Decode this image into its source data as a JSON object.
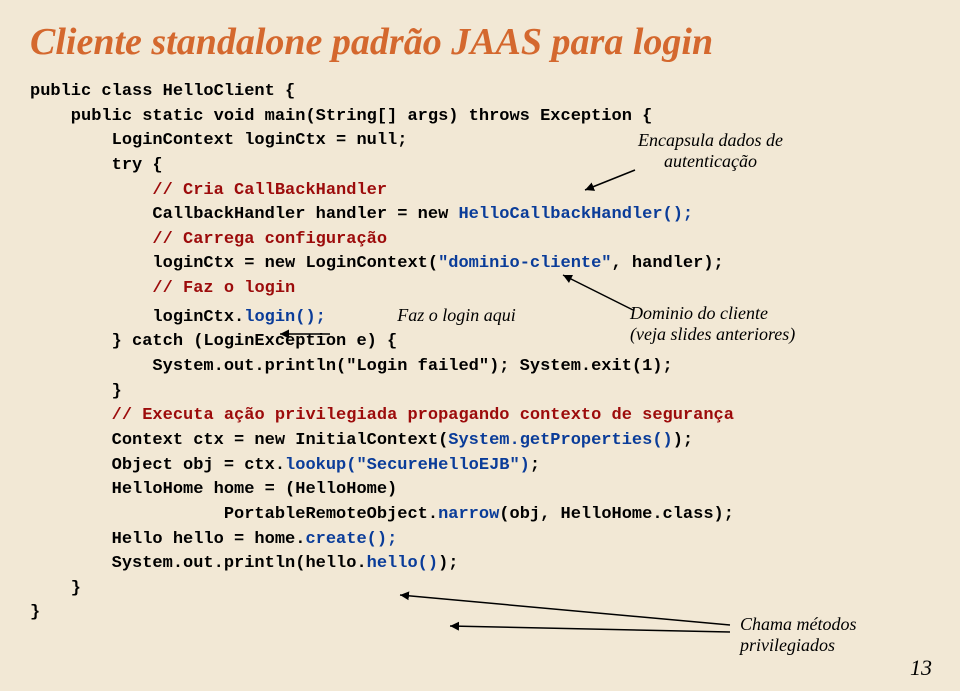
{
  "title": "Cliente standalone padrão JAAS para login",
  "code": {
    "l1": "public class HelloClient {",
    "l2": "    public static void main(String[] args) throws Exception {",
    "l3": "        LoginContext loginCtx = null;",
    "l4": "        try {",
    "l5": "            ",
    "l5c": "// Cria CallBackHandler",
    "l6a": "            CallbackHandler handler = new ",
    "l6b": "HelloCallbackHandler();",
    "l7": "            ",
    "l7c": "// Carrega configuração",
    "l8a": "            loginCtx = new LoginContext(",
    "l8b": "\"dominio-cliente\"",
    "l8c": ", handler);",
    "l9": "            ",
    "l9c": "// Faz o login",
    "l10a": "            loginCtx.",
    "l10b": "login();",
    "l11": "        } catch (LoginException e) {",
    "l12": "            System.out.println(\"Login failed\"); System.exit(1);",
    "l13": "        }",
    "l14": "        ",
    "l14c": "// Executa ação privilegiada propagando contexto de segurança",
    "l15a": "        Context ctx = new InitialContext(",
    "l15b": "System.getProperties()",
    "l15c": ");",
    "l16a": "        Object obj = ctx.",
    "l16b": "lookup(\"SecureHelloEJB\")",
    "l16c": ";",
    "l17": "        HelloHome home = (HelloHome)",
    "l18a": "                   PortableRemoteObject.",
    "l18b": "narrow",
    "l18c": "(obj, HelloHome.class);",
    "l19a": "        Hello hello = home.",
    "l19b": "create();",
    "l20a": "        System.out.println(hello.",
    "l20b": "hello()",
    "l20c": ");",
    "l21": "    }",
    "l22": "}"
  },
  "annot": {
    "enc1": "Encapsula dados de",
    "enc2": "autenticação",
    "login": "Faz o login aqui",
    "dom1": "Dominio do cliente",
    "dom2": "(veja slides anteriores)",
    "calls1": "Chama métodos",
    "calls2": "privilegiados"
  },
  "page": "13"
}
